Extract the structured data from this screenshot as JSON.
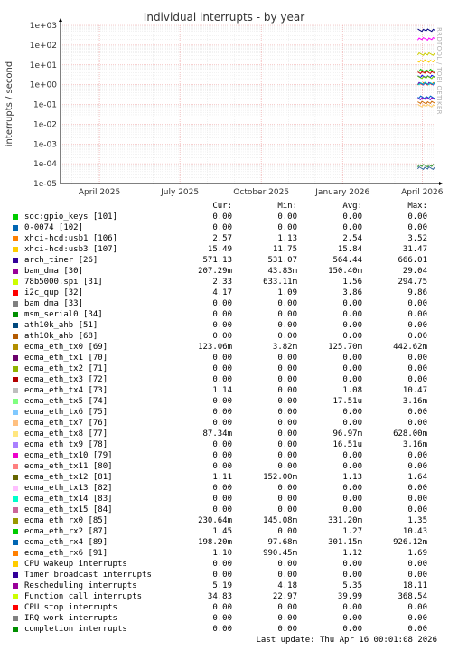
{
  "chart_data": {
    "type": "line",
    "title": "Individual interrupts - by year",
    "ylabel": "interrupts / second",
    "y_scale": "log",
    "ylim": [
      1e-05,
      1000
    ],
    "y_ticks": [
      "1e+03",
      "1e+02",
      "1e+01",
      "1e+00",
      "1e-01",
      "1e-02",
      "1e-03",
      "1e-04",
      "1e-05"
    ],
    "x_ticks": [
      "April 2025",
      "July 2025",
      "October 2025",
      "January 2026",
      "April 2026"
    ],
    "x_range": [
      "2025-02-16",
      "2026-04-16"
    ],
    "data_start": "2026-03-27",
    "grid": true,
    "watermark": "RRDTOOL / TOBI OETIKER",
    "series_levels": [
      {
        "color": "#000080",
        "value": 571.13
      },
      {
        "color": "#ff00ff",
        "value": 207.29
      },
      {
        "color": "#cccc00",
        "value": 34.83
      },
      {
        "color": "#ffcc00",
        "value": 15.49
      },
      {
        "color": "#00cc00",
        "value": 5.19
      },
      {
        "color": "#cc0000",
        "value": 4.17
      },
      {
        "color": "#0000ff",
        "value": 2.57
      },
      {
        "color": "#66cc00",
        "value": 2.33
      },
      {
        "color": "#ff6600",
        "value": 1.1
      },
      {
        "color": "#6600cc",
        "value": 1.11
      },
      {
        "color": "#00cccc",
        "value": 1.14
      },
      {
        "color": "#0066cc",
        "value": 0.23
      },
      {
        "color": "#9900cc",
        "value": 0.198
      },
      {
        "color": "#cc6600",
        "value": 0.123
      },
      {
        "color": "#ffcc66",
        "value": 0.087
      },
      {
        "color": "#339933",
        "value": 8e-05
      },
      {
        "color": "#336699",
        "value": 6e-05
      }
    ]
  },
  "legend": {
    "headers": [
      "Cur:",
      "Min:",
      "Avg:",
      "Max:"
    ],
    "rows": [
      {
        "color": "#00cc00",
        "name": "soc:gpio_keys [101]",
        "cur": "0.00",
        "min": "0.00",
        "avg": "0.00",
        "max": "0.00"
      },
      {
        "color": "#0066b3",
        "name": "0-0074 [102]",
        "cur": "0.00",
        "min": "0.00",
        "avg": "0.00",
        "max": "0.00"
      },
      {
        "color": "#ff8000",
        "name": "xhci-hcd:usb1 [106]",
        "cur": "2.57",
        "min": "1.13",
        "avg": "2.54",
        "max": "3.52"
      },
      {
        "color": "#ffcc00",
        "name": "xhci-hcd:usb3 [107]",
        "cur": "15.49",
        "min": "11.75",
        "avg": "15.84",
        "max": "31.47"
      },
      {
        "color": "#330099",
        "name": "arch_timer [26]",
        "cur": "571.13",
        "min": "531.07",
        "avg": "564.44",
        "max": "666.01"
      },
      {
        "color": "#990099",
        "name": "bam_dma [30]",
        "cur": "207.29m",
        "min": "43.83m",
        "avg": "150.40m",
        "max": "29.04"
      },
      {
        "color": "#ccff00",
        "name": "78b5000.spi [31]",
        "cur": "2.33",
        "min": "633.11m",
        "avg": "1.56",
        "max": "294.75"
      },
      {
        "color": "#ff0000",
        "name": "i2c_qup [32]",
        "cur": "4.17",
        "min": "1.09",
        "avg": "3.86",
        "max": "9.86"
      },
      {
        "color": "#808080",
        "name": "bam_dma [33]",
        "cur": "0.00",
        "min": "0.00",
        "avg": "0.00",
        "max": "0.00"
      },
      {
        "color": "#008f00",
        "name": "msm_serial0 [34]",
        "cur": "0.00",
        "min": "0.00",
        "avg": "0.00",
        "max": "0.00"
      },
      {
        "color": "#00487d",
        "name": "ath10k_ahb [51]",
        "cur": "0.00",
        "min": "0.00",
        "avg": "0.00",
        "max": "0.00"
      },
      {
        "color": "#b35a00",
        "name": "ath10k_ahb [68]",
        "cur": "0.00",
        "min": "0.00",
        "avg": "0.00",
        "max": "0.00"
      },
      {
        "color": "#b38f00",
        "name": "edma_eth_tx0 [69]",
        "cur": "123.06m",
        "min": "3.82m",
        "avg": "125.70m",
        "max": "442.62m"
      },
      {
        "color": "#6b006b",
        "name": "edma_eth_tx1 [70]",
        "cur": "0.00",
        "min": "0.00",
        "avg": "0.00",
        "max": "0.00"
      },
      {
        "color": "#8fb300",
        "name": "edma_eth_tx2 [71]",
        "cur": "0.00",
        "min": "0.00",
        "avg": "0.00",
        "max": "0.00"
      },
      {
        "color": "#b30000",
        "name": "edma_eth_tx3 [72]",
        "cur": "0.00",
        "min": "0.00",
        "avg": "0.00",
        "max": "0.00"
      },
      {
        "color": "#bebebe",
        "name": "edma_eth_tx4 [73]",
        "cur": "1.14",
        "min": "0.00",
        "avg": "1.08",
        "max": "10.47"
      },
      {
        "color": "#80ff80",
        "name": "edma_eth_tx5 [74]",
        "cur": "0.00",
        "min": "0.00",
        "avg": "17.51u",
        "max": "3.16m"
      },
      {
        "color": "#80c9ff",
        "name": "edma_eth_tx6 [75]",
        "cur": "0.00",
        "min": "0.00",
        "avg": "0.00",
        "max": "0.00"
      },
      {
        "color": "#ffc080",
        "name": "edma_eth_tx7 [76]",
        "cur": "0.00",
        "min": "0.00",
        "avg": "0.00",
        "max": "0.00"
      },
      {
        "color": "#ffe680",
        "name": "edma_eth_tx8 [77]",
        "cur": "87.34m",
        "min": "0.00",
        "avg": "96.97m",
        "max": "628.00m"
      },
      {
        "color": "#aa80ff",
        "name": "edma_eth_tx9 [78]",
        "cur": "0.00",
        "min": "0.00",
        "avg": "16.51u",
        "max": "3.16m"
      },
      {
        "color": "#ee00cc",
        "name": "edma_eth_tx10 [79]",
        "cur": "0.00",
        "min": "0.00",
        "avg": "0.00",
        "max": "0.00"
      },
      {
        "color": "#ff8080",
        "name": "edma_eth_tx11 [80]",
        "cur": "0.00",
        "min": "0.00",
        "avg": "0.00",
        "max": "0.00"
      },
      {
        "color": "#666600",
        "name": "edma_eth_tx12 [81]",
        "cur": "1.11",
        "min": "152.00m",
        "avg": "1.13",
        "max": "1.64"
      },
      {
        "color": "#ffbfff",
        "name": "edma_eth_tx13 [82]",
        "cur": "0.00",
        "min": "0.00",
        "avg": "0.00",
        "max": "0.00"
      },
      {
        "color": "#00ffcc",
        "name": "edma_eth_tx14 [83]",
        "cur": "0.00",
        "min": "0.00",
        "avg": "0.00",
        "max": "0.00"
      },
      {
        "color": "#cc6699",
        "name": "edma_eth_tx15 [84]",
        "cur": "0.00",
        "min": "0.00",
        "avg": "0.00",
        "max": "0.00"
      },
      {
        "color": "#999900",
        "name": "edma_eth_rx0 [85]",
        "cur": "230.64m",
        "min": "145.08m",
        "avg": "331.20m",
        "max": "1.35"
      },
      {
        "color": "#00cc00",
        "name": "edma_eth_rx2 [87]",
        "cur": "1.45",
        "min": "0.00",
        "avg": "1.27",
        "max": "10.43"
      },
      {
        "color": "#0066b3",
        "name": "edma_eth_rx4 [89]",
        "cur": "198.20m",
        "min": "97.68m",
        "avg": "301.15m",
        "max": "926.12m"
      },
      {
        "color": "#ff8000",
        "name": "edma_eth_rx6 [91]",
        "cur": "1.10",
        "min": "990.45m",
        "avg": "1.12",
        "max": "1.69"
      },
      {
        "color": "#ffcc00",
        "name": "CPU wakeup interrupts",
        "cur": "0.00",
        "min": "0.00",
        "avg": "0.00",
        "max": "0.00"
      },
      {
        "color": "#330099",
        "name": "Timer broadcast interrupts",
        "cur": "0.00",
        "min": "0.00",
        "avg": "0.00",
        "max": "0.00"
      },
      {
        "color": "#990099",
        "name": "Rescheduling interrupts",
        "cur": "5.19",
        "min": "4.18",
        "avg": "5.35",
        "max": "18.11"
      },
      {
        "color": "#ccff00",
        "name": "Function call interrupts",
        "cur": "34.83",
        "min": "22.97",
        "avg": "39.99",
        "max": "368.54"
      },
      {
        "color": "#ff0000",
        "name": "CPU stop interrupts",
        "cur": "0.00",
        "min": "0.00",
        "avg": "0.00",
        "max": "0.00"
      },
      {
        "color": "#808080",
        "name": "IRQ work interrupts",
        "cur": "0.00",
        "min": "0.00",
        "avg": "0.00",
        "max": "0.00"
      },
      {
        "color": "#008f00",
        "name": "completion interrupts",
        "cur": "0.00",
        "min": "0.00",
        "avg": "0.00",
        "max": "0.00"
      }
    ]
  },
  "footer": "Last update: Thu Apr 16 00:01:08 2026"
}
